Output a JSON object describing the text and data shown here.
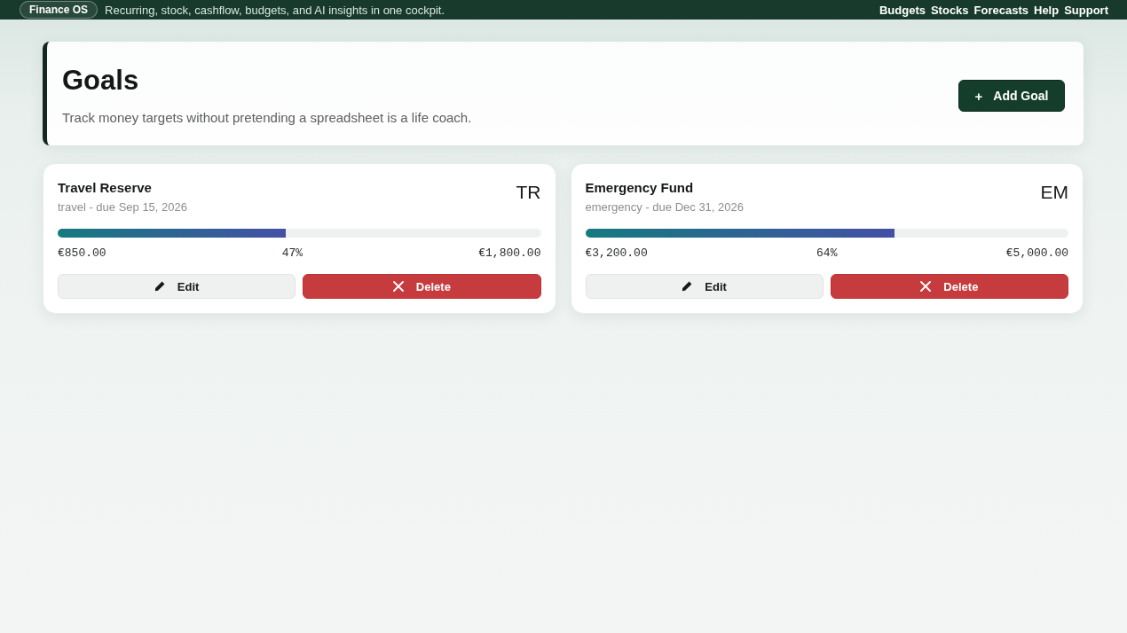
{
  "top_bar": {
    "brand": "Finance OS",
    "tagline": "Recurring, stock, cashflow, budgets, and AI insights in one cockpit.",
    "nav": [
      "Budgets",
      "Stocks",
      "Forecasts",
      "Help",
      "Support"
    ]
  },
  "header": {
    "title": "Goals",
    "subtitle": "Track money targets without pretending a spreadsheet is a life coach.",
    "add_button": {
      "icon": "+",
      "label": "Add Goal"
    }
  },
  "goals": [
    {
      "name": "Travel Reserve",
      "meta": "travel - due Sep 15, 2026",
      "initials": "TR",
      "level": 0.472,
      "saved": "€850.00",
      "percent": "47%",
      "target": "€1,800.00",
      "actions": [
        {
          "kind": "edit",
          "label": "Edit"
        },
        {
          "kind": "delete",
          "label": "Delete"
        }
      ]
    },
    {
      "name": "Emergency Fund",
      "meta": "emergency - due Dec 31, 2026",
      "initials": "EM",
      "level": 0.64,
      "saved": "€3,200.00",
      "percent": "64%",
      "target": "€5,000.00",
      "actions": [
        {
          "kind": "edit",
          "label": "Edit"
        },
        {
          "kind": "delete",
          "label": "Delete"
        }
      ]
    }
  ]
}
